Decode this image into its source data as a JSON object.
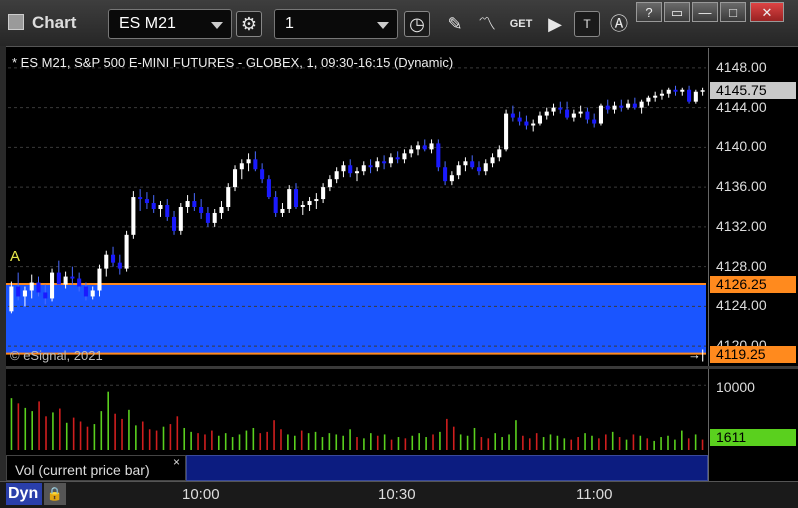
{
  "window": {
    "app_title": "Chart",
    "symbol": "ES M21",
    "interval": "1",
    "buttons": [
      "clock-icon",
      "pencil-icon",
      "study-icon",
      "get-icon",
      "play-icon",
      "text-icon",
      "alert-icon"
    ],
    "controls": [
      "?",
      "▭",
      "—",
      "□",
      "✕"
    ]
  },
  "chart_title": "* ES M21, S&P 500 E-MINI FUTURES - GLOBEX, 1, 09:30-16:15 (Dynamic)",
  "copyright": "© eSignal, 2021",
  "alert_marker": "A",
  "last_price_tag": "4145.75",
  "upper_line_tag": "4126.25",
  "lower_line_tag": "4119.25",
  "vol_tag": "1611",
  "vol_study_label": "Vol (current price bar)",
  "vol_study_close": "×",
  "dyn_label": "Dyn",
  "lock_label": "🔒",
  "chart_data": {
    "type": "candlestick",
    "title": "* ES M21, S&P 500 E-MINI FUTURES - GLOBEX, 1, 09:30-16:15 (Dynamic)",
    "ylim": [
      4118,
      4150
    ],
    "yticks": [
      "4148.00",
      "4144.00",
      "4140.00",
      "4136.00",
      "4132.00",
      "4128.00",
      "4124.00",
      "4120.00"
    ],
    "xticks": [
      "10:00",
      "10:30",
      "11:00"
    ],
    "hlines": [
      {
        "price": 4126.25,
        "color": "#ff8a1e"
      },
      {
        "price": 4119.25,
        "color": "#ff8a1e"
      }
    ],
    "zone": {
      "from": 4119.25,
      "to": 4126.25,
      "color": "#1a55ff"
    },
    "up_color": "#ffffff",
    "down_color": "#1a1aff",
    "candles": [
      [
        4123.5,
        4126.5,
        4123.3,
        4126.0
      ],
      [
        4126.0,
        4127.4,
        4124.6,
        4125.0
      ],
      [
        4125.0,
        4126.0,
        4124.0,
        4125.6
      ],
      [
        4125.6,
        4127.2,
        4124.8,
        4126.4
      ],
      [
        4126.4,
        4127.0,
        4125.0,
        4125.4
      ],
      [
        4125.4,
        4126.2,
        4124.2,
        4124.8
      ],
      [
        4124.8,
        4127.8,
        4124.5,
        4127.4
      ],
      [
        4127.4,
        4128.6,
        4126.8,
        4126.2
      ],
      [
        4126.2,
        4127.5,
        4125.8,
        4127.0
      ],
      [
        4127.0,
        4128.0,
        4126.2,
        4126.8
      ],
      [
        4126.8,
        4127.4,
        4125.5,
        4126.0
      ],
      [
        4126.0,
        4126.4,
        4124.6,
        4125.0
      ],
      [
        4125.0,
        4126.0,
        4124.7,
        4125.6
      ],
      [
        4125.6,
        4128.2,
        4125.0,
        4127.8
      ],
      [
        4127.8,
        4129.6,
        4127.0,
        4129.2
      ],
      [
        4129.2,
        4130.0,
        4128.0,
        4128.4
      ],
      [
        4128.4,
        4129.2,
        4127.2,
        4127.8
      ],
      [
        4127.8,
        4131.6,
        4127.5,
        4131.2
      ],
      [
        4131.2,
        4135.6,
        4130.8,
        4135.0
      ],
      [
        4135.0,
        4135.8,
        4133.6,
        4134.8
      ],
      [
        4134.8,
        4135.5,
        4133.8,
        4134.4
      ],
      [
        4134.4,
        4135.2,
        4133.4,
        4133.8
      ],
      [
        4133.8,
        4134.6,
        4133.0,
        4134.2
      ],
      [
        4134.2,
        4134.8,
        4132.6,
        4133.0
      ],
      [
        4133.0,
        4133.6,
        4131.2,
        4131.6
      ],
      [
        4131.6,
        4134.4,
        4131.2,
        4134.0
      ],
      [
        4134.0,
        4135.2,
        4133.4,
        4134.6
      ],
      [
        4134.6,
        4135.4,
        4133.6,
        4134.0
      ],
      [
        4134.0,
        4134.8,
        4132.8,
        4133.4
      ],
      [
        4133.4,
        4134.0,
        4132.0,
        4132.4
      ],
      [
        4132.4,
        4133.8,
        4132.0,
        4133.4
      ],
      [
        4133.4,
        4134.6,
        4132.8,
        4134.0
      ],
      [
        4134.0,
        4136.4,
        4133.6,
        4136.0
      ],
      [
        4136.0,
        4138.2,
        4135.6,
        4137.8
      ],
      [
        4137.8,
        4138.8,
        4136.8,
        4138.4
      ],
      [
        4138.4,
        4139.4,
        4137.6,
        4138.8
      ],
      [
        4138.8,
        4139.6,
        4137.6,
        4137.8
      ],
      [
        4137.8,
        4138.4,
        4136.4,
        4136.8
      ],
      [
        4136.8,
        4137.2,
        4134.8,
        4135.0
      ],
      [
        4135.0,
        4135.6,
        4133.0,
        4133.4
      ],
      [
        4133.4,
        4134.4,
        4133.0,
        4133.8
      ],
      [
        4133.8,
        4136.2,
        4133.4,
        4135.8
      ],
      [
        4135.8,
        4136.4,
        4133.8,
        4134.0
      ],
      [
        4134.0,
        4134.6,
        4133.2,
        4134.2
      ],
      [
        4134.2,
        4135.0,
        4133.6,
        4134.6
      ],
      [
        4134.6,
        4135.4,
        4133.8,
        4134.8
      ],
      [
        4134.8,
        4136.4,
        4134.4,
        4136.0
      ],
      [
        4136.0,
        4137.2,
        4135.6,
        4136.8
      ],
      [
        4136.8,
        4138.0,
        4136.4,
        4137.6
      ],
      [
        4137.6,
        4138.6,
        4137.0,
        4138.2
      ],
      [
        4138.2,
        4138.8,
        4137.0,
        4137.4
      ],
      [
        4137.4,
        4138.0,
        4136.6,
        4137.6
      ],
      [
        4137.6,
        4138.6,
        4137.2,
        4138.2
      ],
      [
        4138.2,
        4138.8,
        4137.4,
        4138.0
      ],
      [
        4138.0,
        4139.0,
        4137.6,
        4138.6
      ],
      [
        4138.6,
        4139.2,
        4137.8,
        4138.4
      ],
      [
        4138.4,
        4139.4,
        4138.0,
        4139.0
      ],
      [
        4139.0,
        4139.6,
        4138.4,
        4138.8
      ],
      [
        4138.8,
        4139.8,
        4138.4,
        4139.4
      ],
      [
        4139.4,
        4140.2,
        4139.0,
        4139.8
      ],
      [
        4139.8,
        4140.6,
        4139.2,
        4140.2
      ],
      [
        4140.2,
        4140.8,
        4139.6,
        4139.8
      ],
      [
        4139.8,
        4140.8,
        4139.4,
        4140.4
      ],
      [
        4140.4,
        4140.8,
        4137.6,
        4138.0
      ],
      [
        4138.0,
        4138.6,
        4136.2,
        4136.6
      ],
      [
        4136.6,
        4137.6,
        4136.2,
        4137.2
      ],
      [
        4137.2,
        4138.6,
        4136.8,
        4138.2
      ],
      [
        4138.2,
        4139.0,
        4137.6,
        4138.6
      ],
      [
        4138.6,
        4139.2,
        4137.8,
        4138.0
      ],
      [
        4138.0,
        4138.6,
        4137.2,
        4137.6
      ],
      [
        4137.6,
        4138.8,
        4137.2,
        4138.4
      ],
      [
        4138.4,
        4139.4,
        4138.0,
        4139.0
      ],
      [
        4139.0,
        4140.2,
        4138.6,
        4139.8
      ],
      [
        4139.8,
        4143.8,
        4139.6,
        4143.4
      ],
      [
        4143.4,
        4144.2,
        4142.6,
        4143.0
      ],
      [
        4143.0,
        4143.6,
        4142.2,
        4142.6
      ],
      [
        4142.6,
        4143.2,
        4141.8,
        4142.2
      ],
      [
        4142.2,
        4142.8,
        4141.6,
        4142.4
      ],
      [
        4142.4,
        4143.6,
        4142.2,
        4143.2
      ],
      [
        4143.2,
        4144.0,
        4142.8,
        4143.6
      ],
      [
        4143.6,
        4144.4,
        4143.2,
        4144.0
      ],
      [
        4144.0,
        4144.6,
        4143.4,
        4143.8
      ],
      [
        4143.8,
        4144.6,
        4142.8,
        4143.0
      ],
      [
        4143.0,
        4143.8,
        4142.6,
        4143.4
      ],
      [
        4143.4,
        4144.2,
        4143.0,
        4143.6
      ],
      [
        4143.6,
        4144.0,
        4142.4,
        4142.8
      ],
      [
        4142.8,
        4143.4,
        4142.0,
        4142.4
      ],
      [
        4142.4,
        4144.4,
        4142.2,
        4144.2
      ],
      [
        4144.2,
        4144.8,
        4143.4,
        4143.8
      ],
      [
        4143.8,
        4144.6,
        4143.4,
        4144.2
      ],
      [
        4144.2,
        4144.8,
        4143.6,
        4144.0
      ],
      [
        4144.0,
        4144.8,
        4143.8,
        4144.4
      ],
      [
        4144.4,
        4145.0,
        4143.8,
        4144.0
      ],
      [
        4144.0,
        4144.8,
        4143.4,
        4144.6
      ],
      [
        4144.6,
        4145.2,
        4144.2,
        4145.0
      ],
      [
        4145.0,
        4145.6,
        4144.6,
        4145.2
      ],
      [
        4145.2,
        4145.8,
        4144.8,
        4145.4
      ],
      [
        4145.4,
        4146.0,
        4145.0,
        4145.8
      ],
      [
        4145.8,
        4146.2,
        4145.2,
        4145.6
      ],
      [
        4145.6,
        4146.0,
        4145.2,
        4145.8
      ],
      [
        4145.8,
        4146.2,
        4144.4,
        4144.6
      ],
      [
        4144.6,
        4145.8,
        4144.4,
        4145.6
      ],
      [
        4145.6,
        4146.0,
        4145.2,
        4145.75
      ]
    ],
    "volume": {
      "ytick": "10000",
      "ymax": 12500,
      "values": [
        8000,
        7200,
        6500,
        6000,
        7500,
        5200,
        5800,
        6400,
        4200,
        5000,
        4400,
        3600,
        4000,
        6000,
        9000,
        5600,
        4800,
        6200,
        3800,
        4400,
        3200,
        3000,
        3600,
        4000,
        5200,
        3400,
        2800,
        2600,
        2400,
        3000,
        2200,
        2600,
        2000,
        2400,
        3000,
        3400,
        2600,
        2800,
        4600,
        3200,
        2400,
        2200,
        3000,
        2600,
        2800,
        2000,
        2600,
        2400,
        2200,
        3200,
        2000,
        1800,
        2600,
        2200,
        2400,
        1600,
        2000,
        1800,
        2200,
        2600,
        2000,
        2400,
        2800,
        4800,
        3600,
        2400,
        2200,
        3400,
        2000,
        1800,
        2600,
        2000,
        2400,
        4600,
        2200,
        1800,
        2600,
        2000,
        2400,
        2200,
        1800,
        1600,
        2000,
        2600,
        2200,
        1800,
        2400,
        2800,
        2000,
        1600,
        2400,
        2200,
        1800,
        1400,
        2000,
        2200,
        1600,
        3000,
        1800,
        2400,
        1611
      ]
    }
  }
}
